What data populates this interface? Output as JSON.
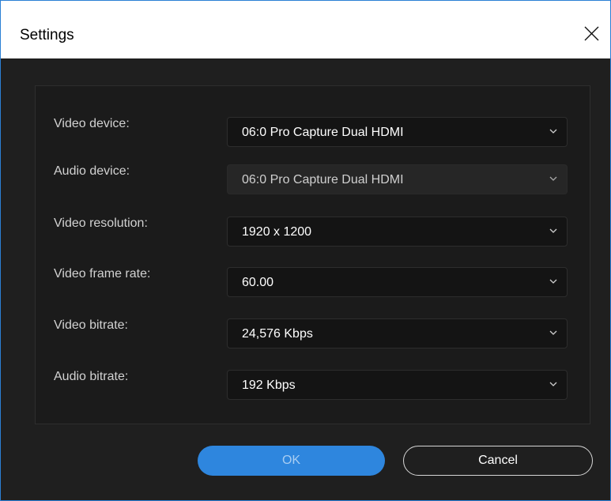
{
  "window": {
    "title": "Settings",
    "close_icon": "close-icon"
  },
  "colors": {
    "accent": "#2e86de",
    "background": "#1f1f1f",
    "panel": "#1b1b1b",
    "field": "#141414",
    "text": "#ffffff",
    "label": "#d2d2d2"
  },
  "fields": [
    {
      "label": "Video device:",
      "value": "06:0 Pro Capture Dual HDMI",
      "disabled": false
    },
    {
      "label": "Audio device:",
      "value": "06:0 Pro Capture Dual HDMI",
      "disabled": true
    },
    {
      "label": "Video resolution:",
      "value": "1920 x 1200",
      "disabled": false
    },
    {
      "label": "Video frame rate:",
      "value": "60.00",
      "disabled": false
    },
    {
      "label": "Video bitrate:",
      "value": "24,576 Kbps",
      "disabled": false
    },
    {
      "label": "Audio bitrate:",
      "value": "192 Kbps",
      "disabled": false
    }
  ],
  "buttons": {
    "ok": "OK",
    "cancel": "Cancel"
  }
}
